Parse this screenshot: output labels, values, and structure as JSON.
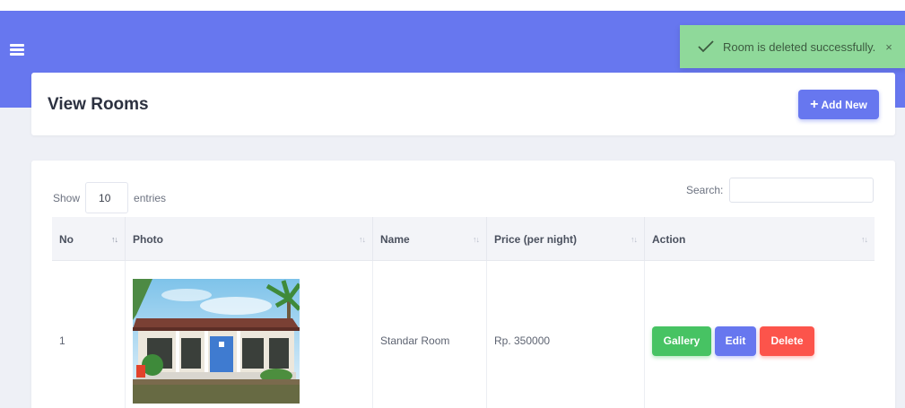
{
  "toast": {
    "message": "Room is deleted successfully.",
    "close_label": "×",
    "color": "#8fd99a"
  },
  "header": {
    "title": "View Rooms",
    "add_label": "Add New",
    "menu_icon": "hamburger-menu-icon",
    "accent_color": "#6777ef"
  },
  "table": {
    "show_label": "Show",
    "entries_value": "10",
    "entries_label": "entries",
    "search_label": "Search:",
    "search_value": "",
    "columns": [
      "No",
      "Photo",
      "Name",
      "Price (per night)",
      "Action"
    ],
    "rows": [
      {
        "no": "1",
        "photo": "room-photo-standar-room",
        "name": "Standar Room",
        "price": "Rp. 350000",
        "actions": [
          "Gallery",
          "Edit",
          "Delete"
        ]
      }
    ]
  },
  "colors": {
    "gallery": "#47c363",
    "edit": "#6777ef",
    "delete": "#fc544b"
  }
}
